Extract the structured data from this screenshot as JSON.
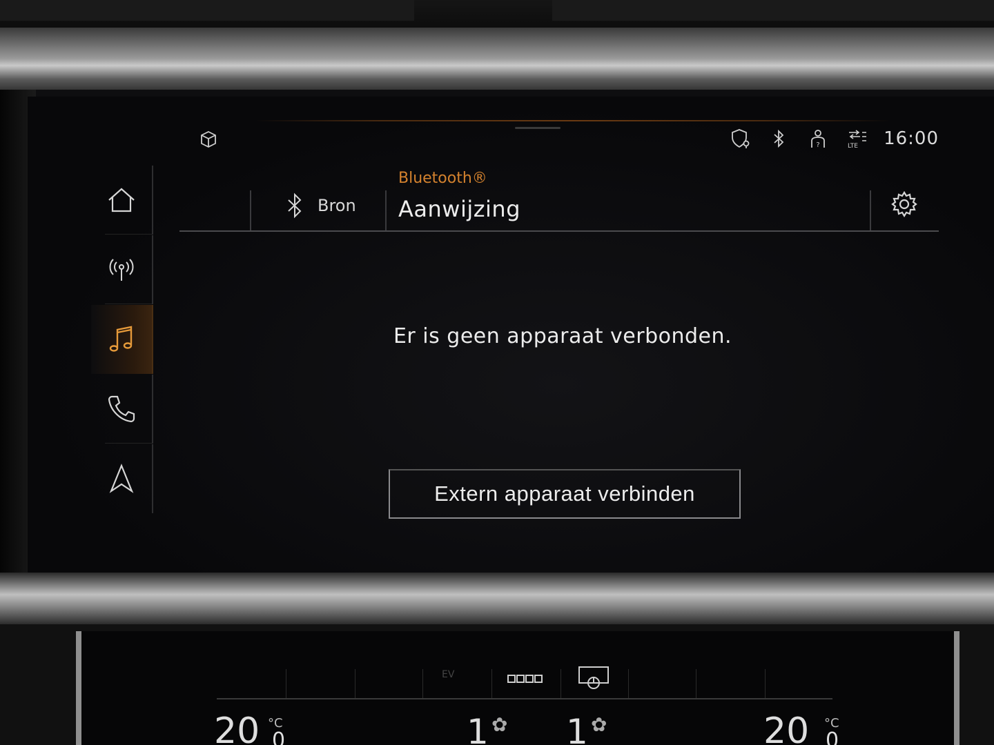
{
  "status_bar": {
    "time": "16:00",
    "icons": [
      "cube-icon",
      "shield-location-icon",
      "bluetooth-icon",
      "person-help-icon",
      "lte-signal-icon"
    ]
  },
  "sidenav": {
    "items": [
      {
        "name": "home",
        "icon": "home-icon"
      },
      {
        "name": "radio",
        "icon": "radio-antenna-icon"
      },
      {
        "name": "media",
        "icon": "music-note-icon",
        "active": true
      },
      {
        "name": "phone",
        "icon": "phone-icon"
      },
      {
        "name": "navigation",
        "icon": "navigation-arrow-icon"
      }
    ]
  },
  "header": {
    "source_label": "Bron",
    "subtitle": "Bluetooth®",
    "title": "Aanwijzing"
  },
  "main": {
    "message": "Er is geen apparaat verbonden.",
    "connect_button": "Extern apparaat verbinden"
  },
  "climate": {
    "left_temp": "20",
    "left_temp_decimal": "0",
    "left_unit": "°C",
    "fan_left": "1",
    "fan_right": "1",
    "right_temp": "20",
    "right_temp_decimal": "0",
    "right_unit": "°C",
    "eco_label": "EV"
  },
  "colors": {
    "accent": "#d4822e",
    "active_icon": "#e69a3a",
    "text": "#ececec"
  }
}
